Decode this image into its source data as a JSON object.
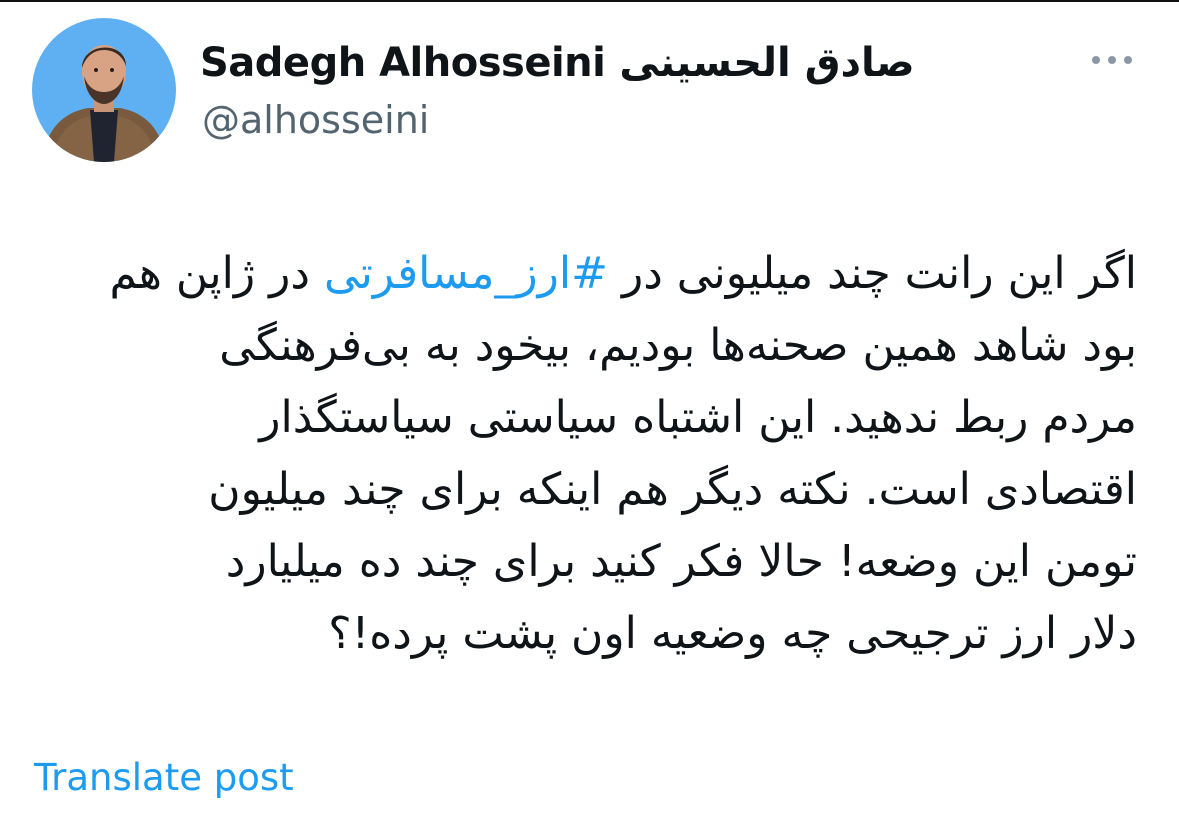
{
  "author": {
    "display_name": "Sadegh Alhosseini",
    "display_name_ar": "صادق الحسینی",
    "handle": "@alhosseini",
    "avatar_icon": "profile-photo"
  },
  "more_icon": "ellipsis-horizontal-icon",
  "tweet": {
    "line1_before": "اگر این رانت چند میلیونی در ",
    "hashtag": "#ارز_مسافرتی",
    "line1_after": " در ژاپن هم",
    "line2": "بود شاهد همین صحنه‌ها بودیم، بیخود به بی‌فرهنگی",
    "line3": "مردم ربط ندهید. این اشتباه سیاستی سیاستگذار",
    "line4": "اقتصادی است. نکته دیگر هم اینکه برای چند میلیون",
    "line5": "تومن این وضعه! حالا فکر کنید برای چند ده میلیارد",
    "line6": "دلار ارز ترجیحی چه وضعیه اون پشت پرده!؟"
  },
  "translate_label": "Translate post",
  "colors": {
    "link": "#1d9bf0",
    "secondary_text": "#536471",
    "avatar_bg": "#5fb0f2"
  }
}
